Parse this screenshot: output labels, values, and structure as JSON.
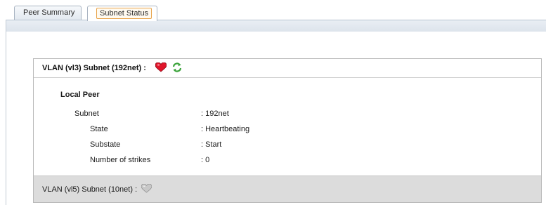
{
  "tabs": [
    {
      "label": "Peer Summary"
    },
    {
      "label": "Subnet Status"
    }
  ],
  "panel": {
    "header_title": "VLAN (vl3) Subnet (192net) :",
    "heart_icon": "heart-icon",
    "refresh_icon": "refresh-icon",
    "local_peer_label": "Local Peer",
    "rows": [
      {
        "label": "Subnet",
        "value": ": 192net"
      },
      {
        "label": "State",
        "value": ": Heartbeating"
      },
      {
        "label": "Substate",
        "value": ": Start"
      },
      {
        "label": "Number of strikes",
        "value": ": 0"
      }
    ],
    "footer_title": "VLAN (vl5) Subnet (10net) :",
    "footer_icon": "heart-icon"
  },
  "colors": {
    "heart_active": "#e0162b",
    "refresh": "#3aa33a",
    "heart_inactive": "#b0b0b0"
  }
}
